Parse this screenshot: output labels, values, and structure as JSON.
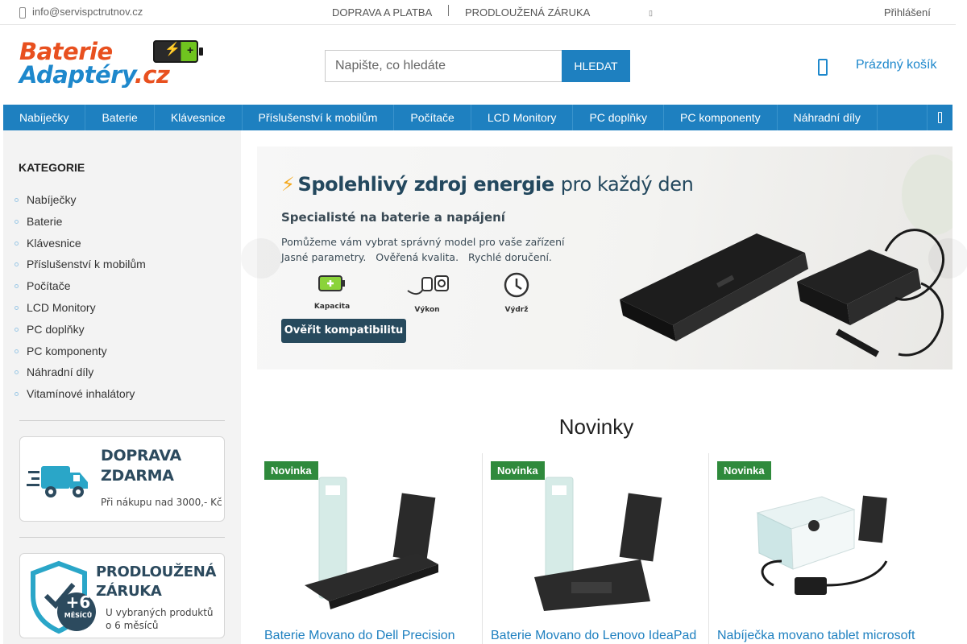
{
  "topbar": {
    "email": "info@servispctrutnov.cz",
    "links": [
      "DOPRAVA A PLATBA",
      "PRODLOUŽENÁ ZÁRUKA"
    ],
    "login": "Přihlášení"
  },
  "logo": {
    "line1": "Baterie",
    "line2": "Adaptéry",
    "tld": ".cz"
  },
  "search": {
    "placeholder": "Napište, co hledáte",
    "button": "HLEDAT"
  },
  "cart": {
    "label": "Prázdný košík"
  },
  "nav": {
    "items": [
      "Nabíječky",
      "Baterie",
      "Klávesnice",
      "Příslušenství k mobilům",
      "Počítače",
      "LCD Monitory",
      "PC doplňky",
      "PC komponenty",
      "Náhradní díly"
    ]
  },
  "sidebar": {
    "heading": "KATEGORIE",
    "categories": [
      "Nabíječky",
      "Baterie",
      "Klávesnice",
      "Příslušenství k mobilům",
      "Počítače",
      "LCD Monitory",
      "PC doplňky",
      "PC komponenty",
      "Náhradní díly",
      "Vitamínové inhalátory"
    ],
    "banner1": {
      "line1": "DOPRAVA",
      "line2": "ZDARMA",
      "sub": "Při nákupu nad 3000,- Kč"
    },
    "banner2": {
      "line1": "PRODLOUŽENÁ",
      "line2": "ZÁRUKA",
      "sub1": "U vybraných produktů",
      "sub2": "o 6 měsíců",
      "badge_num": "+6",
      "badge_txt": "MĚSÍCŮ"
    }
  },
  "hero": {
    "title_bold": "Spolehlivý zdroj energie",
    "title_thin": "pro každý den",
    "subtitle": "Specialisté na baterie a napájení",
    "line1": "Pomůžeme vám vybrat správný model pro vaše zařízení",
    "line2": "Jasné parametry.   Ověřená kvalita.   Rychlé doručení.",
    "features": [
      "Kapacita",
      "Výkon",
      "Výdrž"
    ],
    "cta": "Ověřit kompatibilitu"
  },
  "novinky": {
    "title": "Novinky",
    "products": [
      {
        "badge": "Novinka",
        "name": "Baterie Movano do Dell Precision"
      },
      {
        "badge": "Novinka",
        "name": "Baterie Movano do Lenovo IdeaPad"
      },
      {
        "badge": "Novinka",
        "name": "Nabíječka movano tablet microsoft"
      }
    ]
  },
  "colors": {
    "primary": "#1e80c0",
    "brand_orange": "#e8501f",
    "badge_green": "#2f8a3c"
  }
}
